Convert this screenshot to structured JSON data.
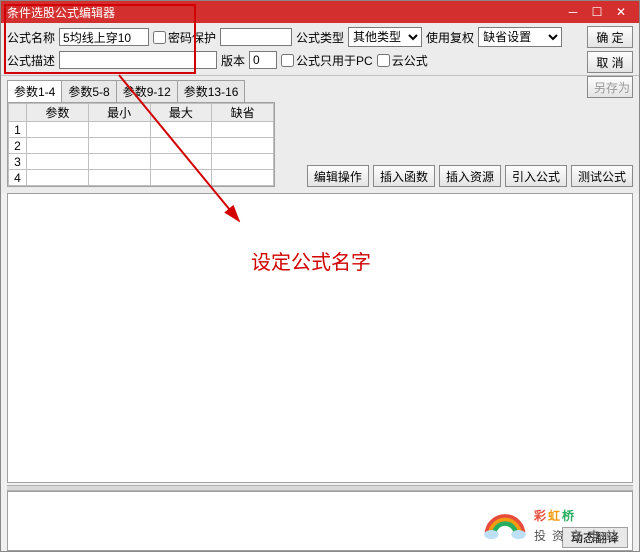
{
  "titlebar": {
    "title": "条件选股公式编辑器"
  },
  "labels": {
    "name": "公式名称",
    "pwd": "密码保护",
    "type": "公式类型",
    "auth": "使用复权",
    "desc": "公式描述",
    "version": "版本",
    "pc_only": "公式只用于PC",
    "cloud": "云公式"
  },
  "fields": {
    "name_value": "5均线上穿10",
    "pwd_value": "",
    "desc_value": "",
    "version_value": "0"
  },
  "selects": {
    "type_selected": "其他类型",
    "auth_selected": "缺省设置"
  },
  "buttons": {
    "ok": "确 定",
    "cancel": "取 消",
    "save_as": "另存为",
    "edit_op": "编辑操作",
    "insert_fn": "插入函数",
    "insert_res": "插入资源",
    "import": "引入公式",
    "test": "测试公式"
  },
  "tabs": {
    "p1": "参数1-4",
    "p2": "参数5-8",
    "p3": "参数9-12",
    "p4": "参数13-16"
  },
  "grid_headers": {
    "param": "参数",
    "min": "最小",
    "max": "最大",
    "default": "缺省"
  },
  "grid_rows": [
    "1",
    "2",
    "3",
    "4"
  ],
  "bottom_tab": "动态翻译",
  "annotation_text": "设定公式名字",
  "watermark": {
    "name": "彩虹桥",
    "sub": "投资充电站"
  }
}
